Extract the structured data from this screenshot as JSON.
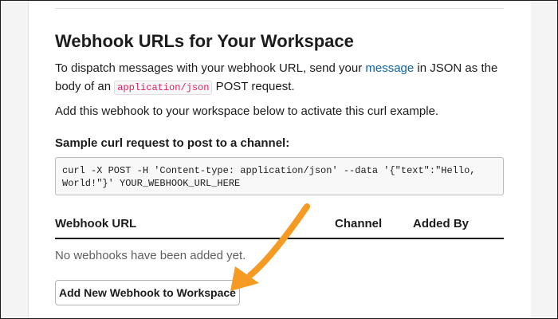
{
  "page": {
    "title": "Webhook URLs for Your Workspace",
    "intro_before_link": "To dispatch messages with your webhook URL, send your ",
    "intro_link": "message",
    "intro_after_link": " in JSON as the body of an ",
    "intro_code": "application/json",
    "intro_end": " POST request.",
    "add_instructions": "Add this webhook to your workspace below to activate this curl example.",
    "sample_label": "Sample curl request to post to a channel:",
    "curl_command": "curl -X POST -H 'Content-type: application/json' --data '{\"text\":\"Hello, World!\"}' YOUR_WEBHOOK_URL_HERE"
  },
  "table": {
    "columns": [
      "Webhook URL",
      "Channel",
      "Added By"
    ],
    "empty_message": "No webhooks have been added yet."
  },
  "actions": {
    "add_button_label": "Add New Webhook to Workspace"
  },
  "colors": {
    "link": "#1264a3",
    "inline_code": "#e01e5a",
    "annotation_arrow": "#f59a23"
  },
  "annotation": {
    "icon": "arrow-annotation-icon"
  }
}
